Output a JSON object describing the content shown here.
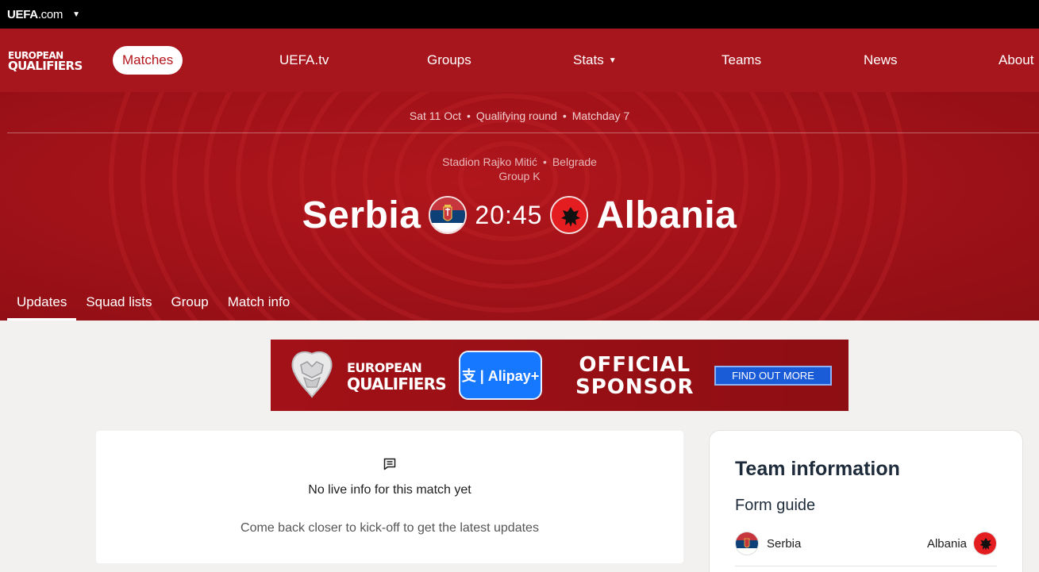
{
  "topbar": {
    "brand_bold": "UEFA",
    "brand_rest": ".com",
    "caret": "▼"
  },
  "nav": {
    "logo_line1": "EUROPEAN",
    "logo_line2": "QUALIFIERS",
    "items": [
      {
        "label": "Matches",
        "active": true
      },
      {
        "label": "UEFA.tv"
      },
      {
        "label": "Groups"
      },
      {
        "label": "Stats",
        "dropdown": "▼"
      },
      {
        "label": "Teams"
      },
      {
        "label": "News"
      },
      {
        "label": "About"
      }
    ]
  },
  "match": {
    "date": "Sat 11 Oct",
    "round": "Qualifying round",
    "matchday": "Matchday 7",
    "separator": "•",
    "stadium": "Stadion Rajko Mitić",
    "city": "Belgrade",
    "group": "Group K",
    "home": "Serbia",
    "away": "Albania",
    "kickoff": "20:45"
  },
  "subtabs": [
    {
      "label": "Updates",
      "active": true
    },
    {
      "label": "Squad lists"
    },
    {
      "label": "Group"
    },
    {
      "label": "Match info"
    }
  ],
  "ad": {
    "brand_line1": "EUROPEAN",
    "brand_line2": "QUALIFIERS",
    "partner": "支 | Alipay+",
    "official_line1": "OFFICIAL",
    "official_line2": "SPONSOR",
    "cta": "FIND OUT MORE"
  },
  "live": {
    "icon": "chat-icon",
    "title": "No live info for this match yet",
    "subtitle": "Come back closer to kick-off to get the latest updates"
  },
  "team_info": {
    "heading": "Team information",
    "subheading": "Form guide",
    "home": "Serbia",
    "away": "Albania"
  },
  "colors": {
    "brand_red": "#a8161d",
    "serbia_red": "#c6363c",
    "serbia_blue": "#0c4076",
    "albania_red": "#e41e20",
    "cta_blue": "#1a5bd8",
    "alipay_blue": "#1677ff"
  }
}
